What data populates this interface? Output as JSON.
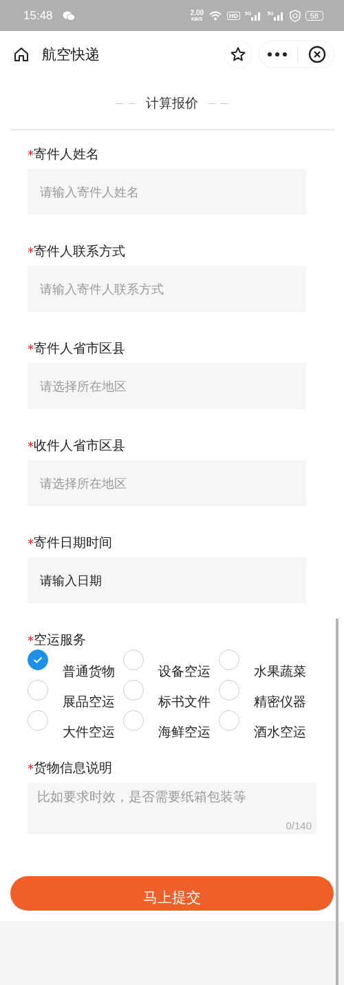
{
  "status_bar": {
    "time": "15:48",
    "speed": "2.00",
    "speed_unit": "KB/S",
    "hd": "HD",
    "signals": [
      "5G",
      "5G"
    ],
    "battery": "58"
  },
  "header": {
    "title": "航空快递"
  },
  "section_title": "计算报价",
  "fields": [
    {
      "mark": "*",
      "label": "寄件人姓名",
      "placeholder": "请输入寄件人姓名"
    },
    {
      "mark": "*",
      "label": "寄件人联系方式",
      "placeholder": "请输入寄件人联系方式"
    },
    {
      "mark": "*",
      "label": "寄件人省市区县",
      "placeholder": "请选择所在地区"
    },
    {
      "mark": "*",
      "label": "收件人省市区县",
      "placeholder": "请选择所在地区"
    },
    {
      "mark": "*",
      "label": "寄件日期时间",
      "value": "请输入日期"
    }
  ],
  "service": {
    "mark": "*",
    "label": "空运服务",
    "options": [
      {
        "label": "普通货物",
        "selected": true
      },
      {
        "label": "设备空运",
        "selected": false
      },
      {
        "label": "水果蔬菜",
        "selected": false
      },
      {
        "label": "展品空运",
        "selected": false
      },
      {
        "label": "标书文件",
        "selected": false
      },
      {
        "label": "精密仪器",
        "selected": false
      },
      {
        "label": "大件空运",
        "selected": false
      },
      {
        "label": "海鲜空运",
        "selected": false
      },
      {
        "label": "酒水空运",
        "selected": false
      }
    ]
  },
  "notes": {
    "mark": "*",
    "label": "货物信息说明",
    "placeholder": "比如要求时效，是否需要纸箱包装等",
    "counter": "0/140"
  },
  "submit": "马上提交"
}
